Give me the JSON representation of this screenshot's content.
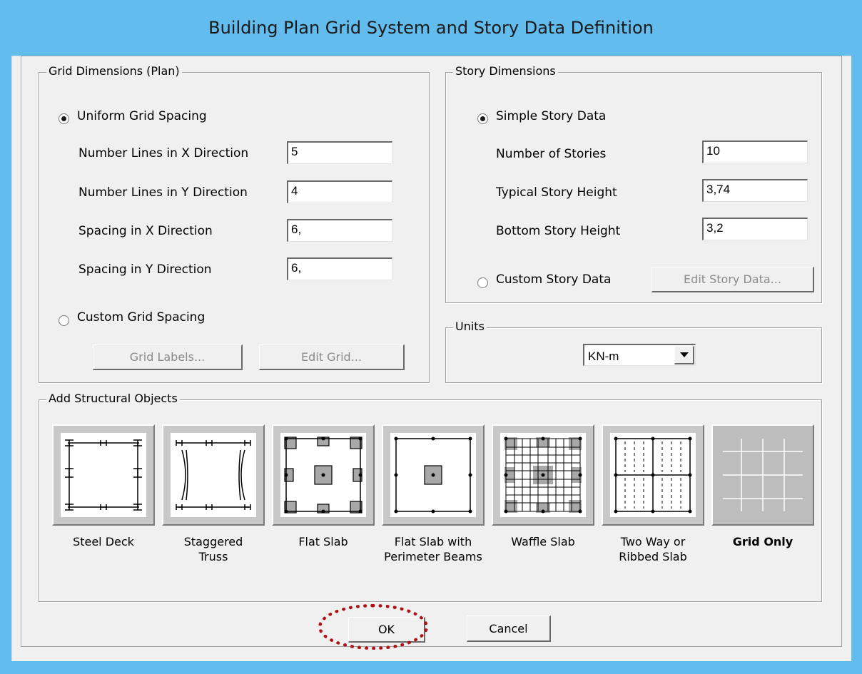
{
  "window": {
    "title": "Building Plan Grid System and Story Data Definition"
  },
  "grid_dimensions": {
    "legend": "Grid Dimensions (Plan)",
    "uniform_label": "Uniform Grid Spacing",
    "uniform_selected": true,
    "fields": [
      {
        "label": "Number Lines in X Direction",
        "value": "5"
      },
      {
        "label": "Number Lines in Y Direction",
        "value": "4"
      },
      {
        "label": "Spacing in X Direction",
        "value": "6,"
      },
      {
        "label": "Spacing in Y Direction",
        "value": "6,"
      }
    ],
    "custom_label": "Custom Grid Spacing",
    "grid_labels_button": "Grid Labels...",
    "edit_grid_button": "Edit Grid..."
  },
  "story_dimensions": {
    "legend": "Story Dimensions",
    "simple_label": "Simple Story Data",
    "simple_selected": true,
    "fields": [
      {
        "label": "Number of Stories",
        "value": "10"
      },
      {
        "label": "Typical Story Height",
        "value": "3,74"
      },
      {
        "label": "Bottom Story Height",
        "value": "3,2"
      }
    ],
    "custom_label": "Custom Story Data",
    "edit_story_button": "Edit Story Data..."
  },
  "units": {
    "legend": "Units",
    "selected": "KN-m"
  },
  "structural_objects": {
    "legend": "Add Structural Objects",
    "items": [
      {
        "line1": "Steel Deck",
        "line2": "",
        "icon": "steel-deck-icon"
      },
      {
        "line1": "Staggered",
        "line2": "Truss",
        "icon": "staggered-truss-icon"
      },
      {
        "line1": "Flat Slab",
        "line2": "",
        "icon": "flat-slab-icon"
      },
      {
        "line1": "Flat Slab with",
        "line2": "Perimeter Beams",
        "icon": "flat-slab-perimeter-beams-icon"
      },
      {
        "line1": "Waffle Slab",
        "line2": "",
        "icon": "waffle-slab-icon"
      },
      {
        "line1": "Two Way or",
        "line2": "Ribbed Slab",
        "icon": "two-way-ribbed-slab-icon"
      },
      {
        "line1": "Grid Only",
        "line2": "",
        "icon": "grid-only-icon",
        "selected": true
      }
    ]
  },
  "footer": {
    "ok_label": "OK",
    "cancel_label": "Cancel"
  },
  "colors": {
    "title_bar": "#62bdee",
    "dialog_bg": "#f0f0f0",
    "highlight": "#b01010"
  }
}
